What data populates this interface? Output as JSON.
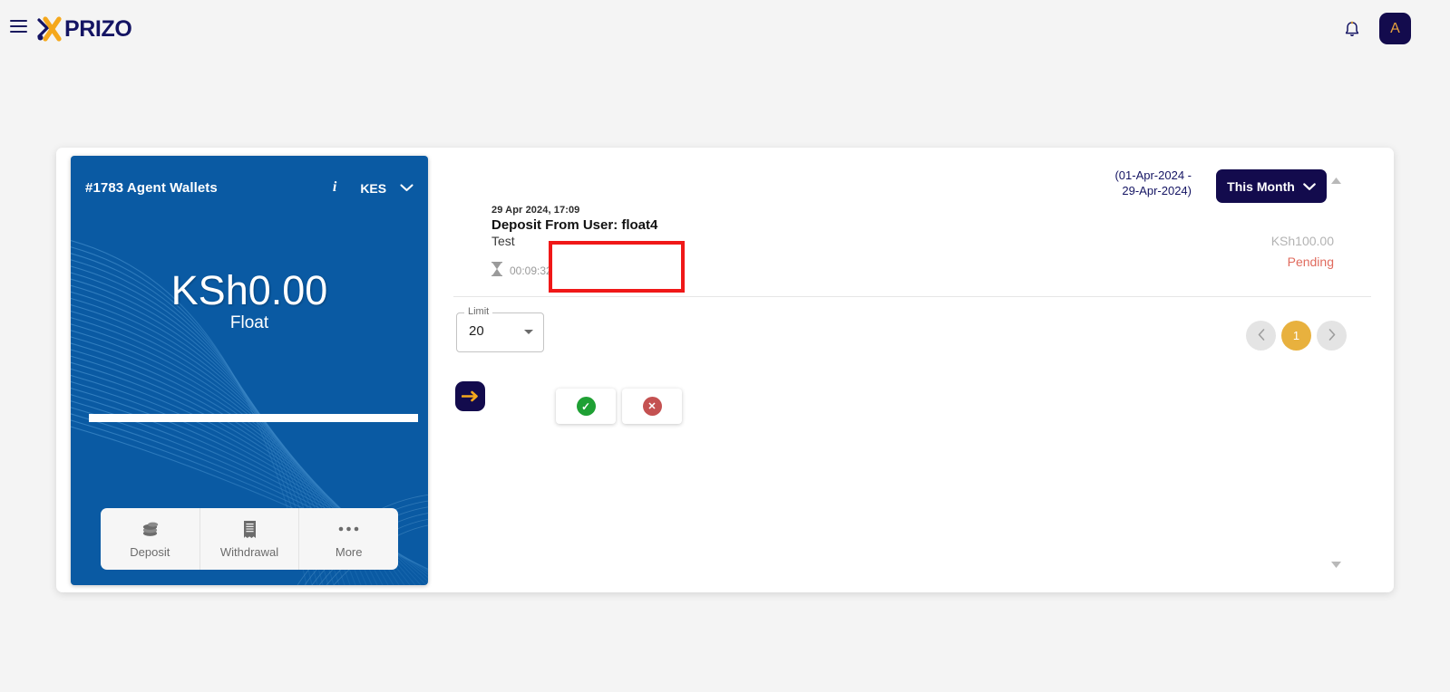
{
  "topbar": {
    "menu_icon": "hamburger-icon",
    "brand": "PRIZO",
    "notification_icon": "bell-icon",
    "avatar_initial": "A"
  },
  "wallet": {
    "title": "#1783 Agent Wallets",
    "info_icon": "info-icon",
    "currency": "KES",
    "currency_chevron": "chevron-down-icon",
    "balance": "KSh0.00",
    "balance_label": "Float",
    "actions": [
      {
        "label": "Deposit",
        "icon": "coins-icon"
      },
      {
        "label": "Withdrawal",
        "icon": "receipt-icon"
      },
      {
        "label": "More",
        "icon": "ellipsis-icon"
      }
    ],
    "card_color": "#0a5aa3"
  },
  "filters": {
    "date_range_line1": "(01-Apr-2024 -",
    "date_range_line2": "29-Apr-2024)",
    "period_button": "This Month",
    "period_chevron": "chevron-down-icon"
  },
  "transaction": {
    "direction_icon": "arrow-right-icon",
    "date": "29 Apr 2024, 17:09",
    "title": "Deposit From User: float4",
    "subtitle": "Test",
    "timer_icon": "hourglass-icon",
    "timer": "00:09:32",
    "amount": "KSh100.00",
    "status": "Pending",
    "status_color": "#e06b5e",
    "approve_icon": "check-circle-icon",
    "reject_icon": "x-circle-icon",
    "highlight_color": "#f01818"
  },
  "footer": {
    "limit_label": "Limit",
    "limit_value": "20",
    "limit_caret": "caret-down-icon",
    "pagination": {
      "prev_icon": "chevron-left-icon",
      "current_page": "1",
      "next_icon": "chevron-right-icon"
    }
  },
  "scroll": {
    "up_icon": "caret-up-icon",
    "down_icon": "caret-down-icon"
  }
}
